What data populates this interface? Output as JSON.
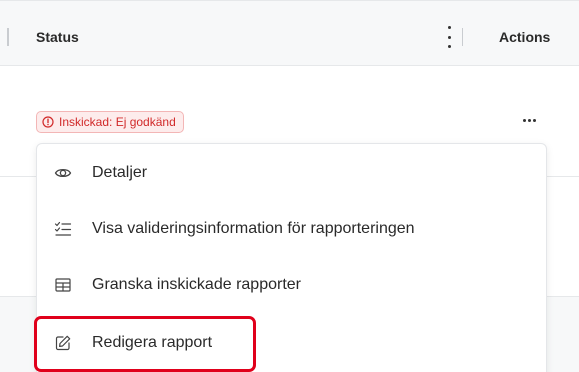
{
  "table": {
    "header": {
      "status_label": "Status",
      "actions_label": "Actions"
    },
    "row": {
      "status_badge": "Inskickad: Ej godkänd",
      "status_badge_color": "#d12a2a"
    }
  },
  "menu": {
    "items": [
      {
        "label": "Detaljer",
        "icon": "eye-icon"
      },
      {
        "label": "Visa valideringsinformation för rapporteringen",
        "icon": "checklist-icon"
      },
      {
        "label": "Granska inskickade rapporter",
        "icon": "table-icon"
      },
      {
        "label": "Redigera rapport",
        "icon": "edit-icon",
        "highlighted": true
      }
    ]
  },
  "colors": {
    "highlight": "#e0001b",
    "badge_background": "#fdecec"
  }
}
